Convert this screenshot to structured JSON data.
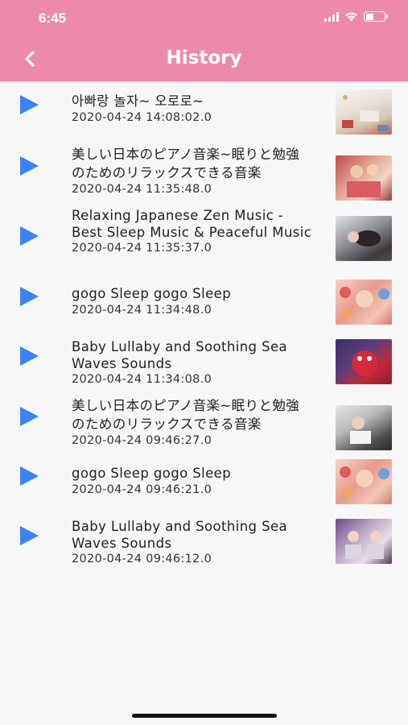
{
  "status_bar": {
    "time": "6:45"
  },
  "header": {
    "title": "History"
  },
  "colors": {
    "header_bg": "#ee8aa9",
    "play_icon": "#3b82f6"
  },
  "items": [
    {
      "title": "아빠랑 놀자~ 오로로~",
      "timestamp": "2020-04-24 14:08:02.0",
      "thumbnail": "nursery-toys-thumbnail"
    },
    {
      "title": "美しい日本のピアノ音楽~眠りと勉強のためのリラックスできる音楽",
      "timestamp": "2020-04-24 11:35:48.0",
      "thumbnail": "baby-in-crib-thumbnail"
    },
    {
      "title": "Relaxing Japanese Zen Music - Best Sleep Music & Peaceful Music",
      "timestamp": "2020-04-24 11:35:37.0",
      "thumbnail": "sleeping-baby-thumbnail"
    },
    {
      "title": "gogo Sleep gogo Sleep",
      "timestamp": "2020-04-24 11:34:48.0",
      "thumbnail": "baby-with-dolls-thumbnail"
    },
    {
      "title": "Baby Lullaby and Soothing Sea Waves Sounds",
      "timestamp": "2020-04-24 11:34:08.0",
      "thumbnail": "red-plush-toy-thumbnail"
    },
    {
      "title": "美しい日本のピアノ音楽~眠りと勉強のためのリラックスできる音楽",
      "timestamp": "2020-04-24 09:46:27.0",
      "thumbnail": "baby-on-blanket-thumbnail"
    },
    {
      "title": "gogo Sleep gogo Sleep",
      "timestamp": "2020-04-24 09:46:21.0",
      "thumbnail": "baby-with-dolls-thumbnail"
    },
    {
      "title": "Baby Lullaby and Soothing Sea Waves Sounds",
      "timestamp": "2020-04-24 09:46:12.0",
      "thumbnail": "two-babies-thumbnail"
    }
  ]
}
